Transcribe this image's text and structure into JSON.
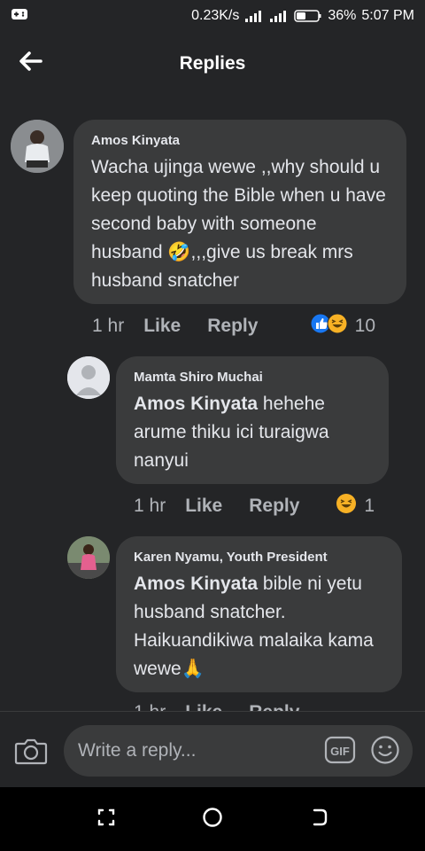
{
  "status_bar": {
    "speed": "0.23K/s",
    "battery": "36%",
    "time": "5:07 PM"
  },
  "header": {
    "title": "Replies"
  },
  "comments": [
    {
      "author": "Amos Kinyata",
      "text": "Wacha ujinga wewe ,,why should u keep quoting the Bible when u have second baby with someone husband 🤣,,,give us break mrs husband snatcher",
      "time": "1 hr",
      "like": "Like",
      "reply": "Reply",
      "reaction_count": "10"
    },
    {
      "author": "Mamta Shiro Muchai",
      "mention": "Amos Kinyata",
      "text": "hehehe arume thiku ici  turaigwa nanyui",
      "time": "1 hr",
      "like": "Like",
      "reply": "Reply",
      "reaction_count": "1"
    },
    {
      "author": "Karen Nyamu, Youth President",
      "mention": "Amos Kinyata",
      "text": "bible ni yetu husband snatcher. Haikuandikiwa malaika kama wewe🙏",
      "time": "1 hr",
      "like": "Like",
      "reply": "Reply"
    }
  ],
  "composer": {
    "placeholder": "Write a reply..."
  },
  "colors": {
    "background": "#242527",
    "bubble": "#3a3b3c",
    "like_blue": "#1877f2",
    "haha_yellow": "#f7b125"
  },
  "icons": {
    "back": "arrow-left-icon",
    "camera": "camera-icon",
    "gif": "gif-icon",
    "emoji": "emoji-icon",
    "like_reaction": "like-reaction-icon",
    "haha_reaction": "haha-reaction-icon"
  }
}
